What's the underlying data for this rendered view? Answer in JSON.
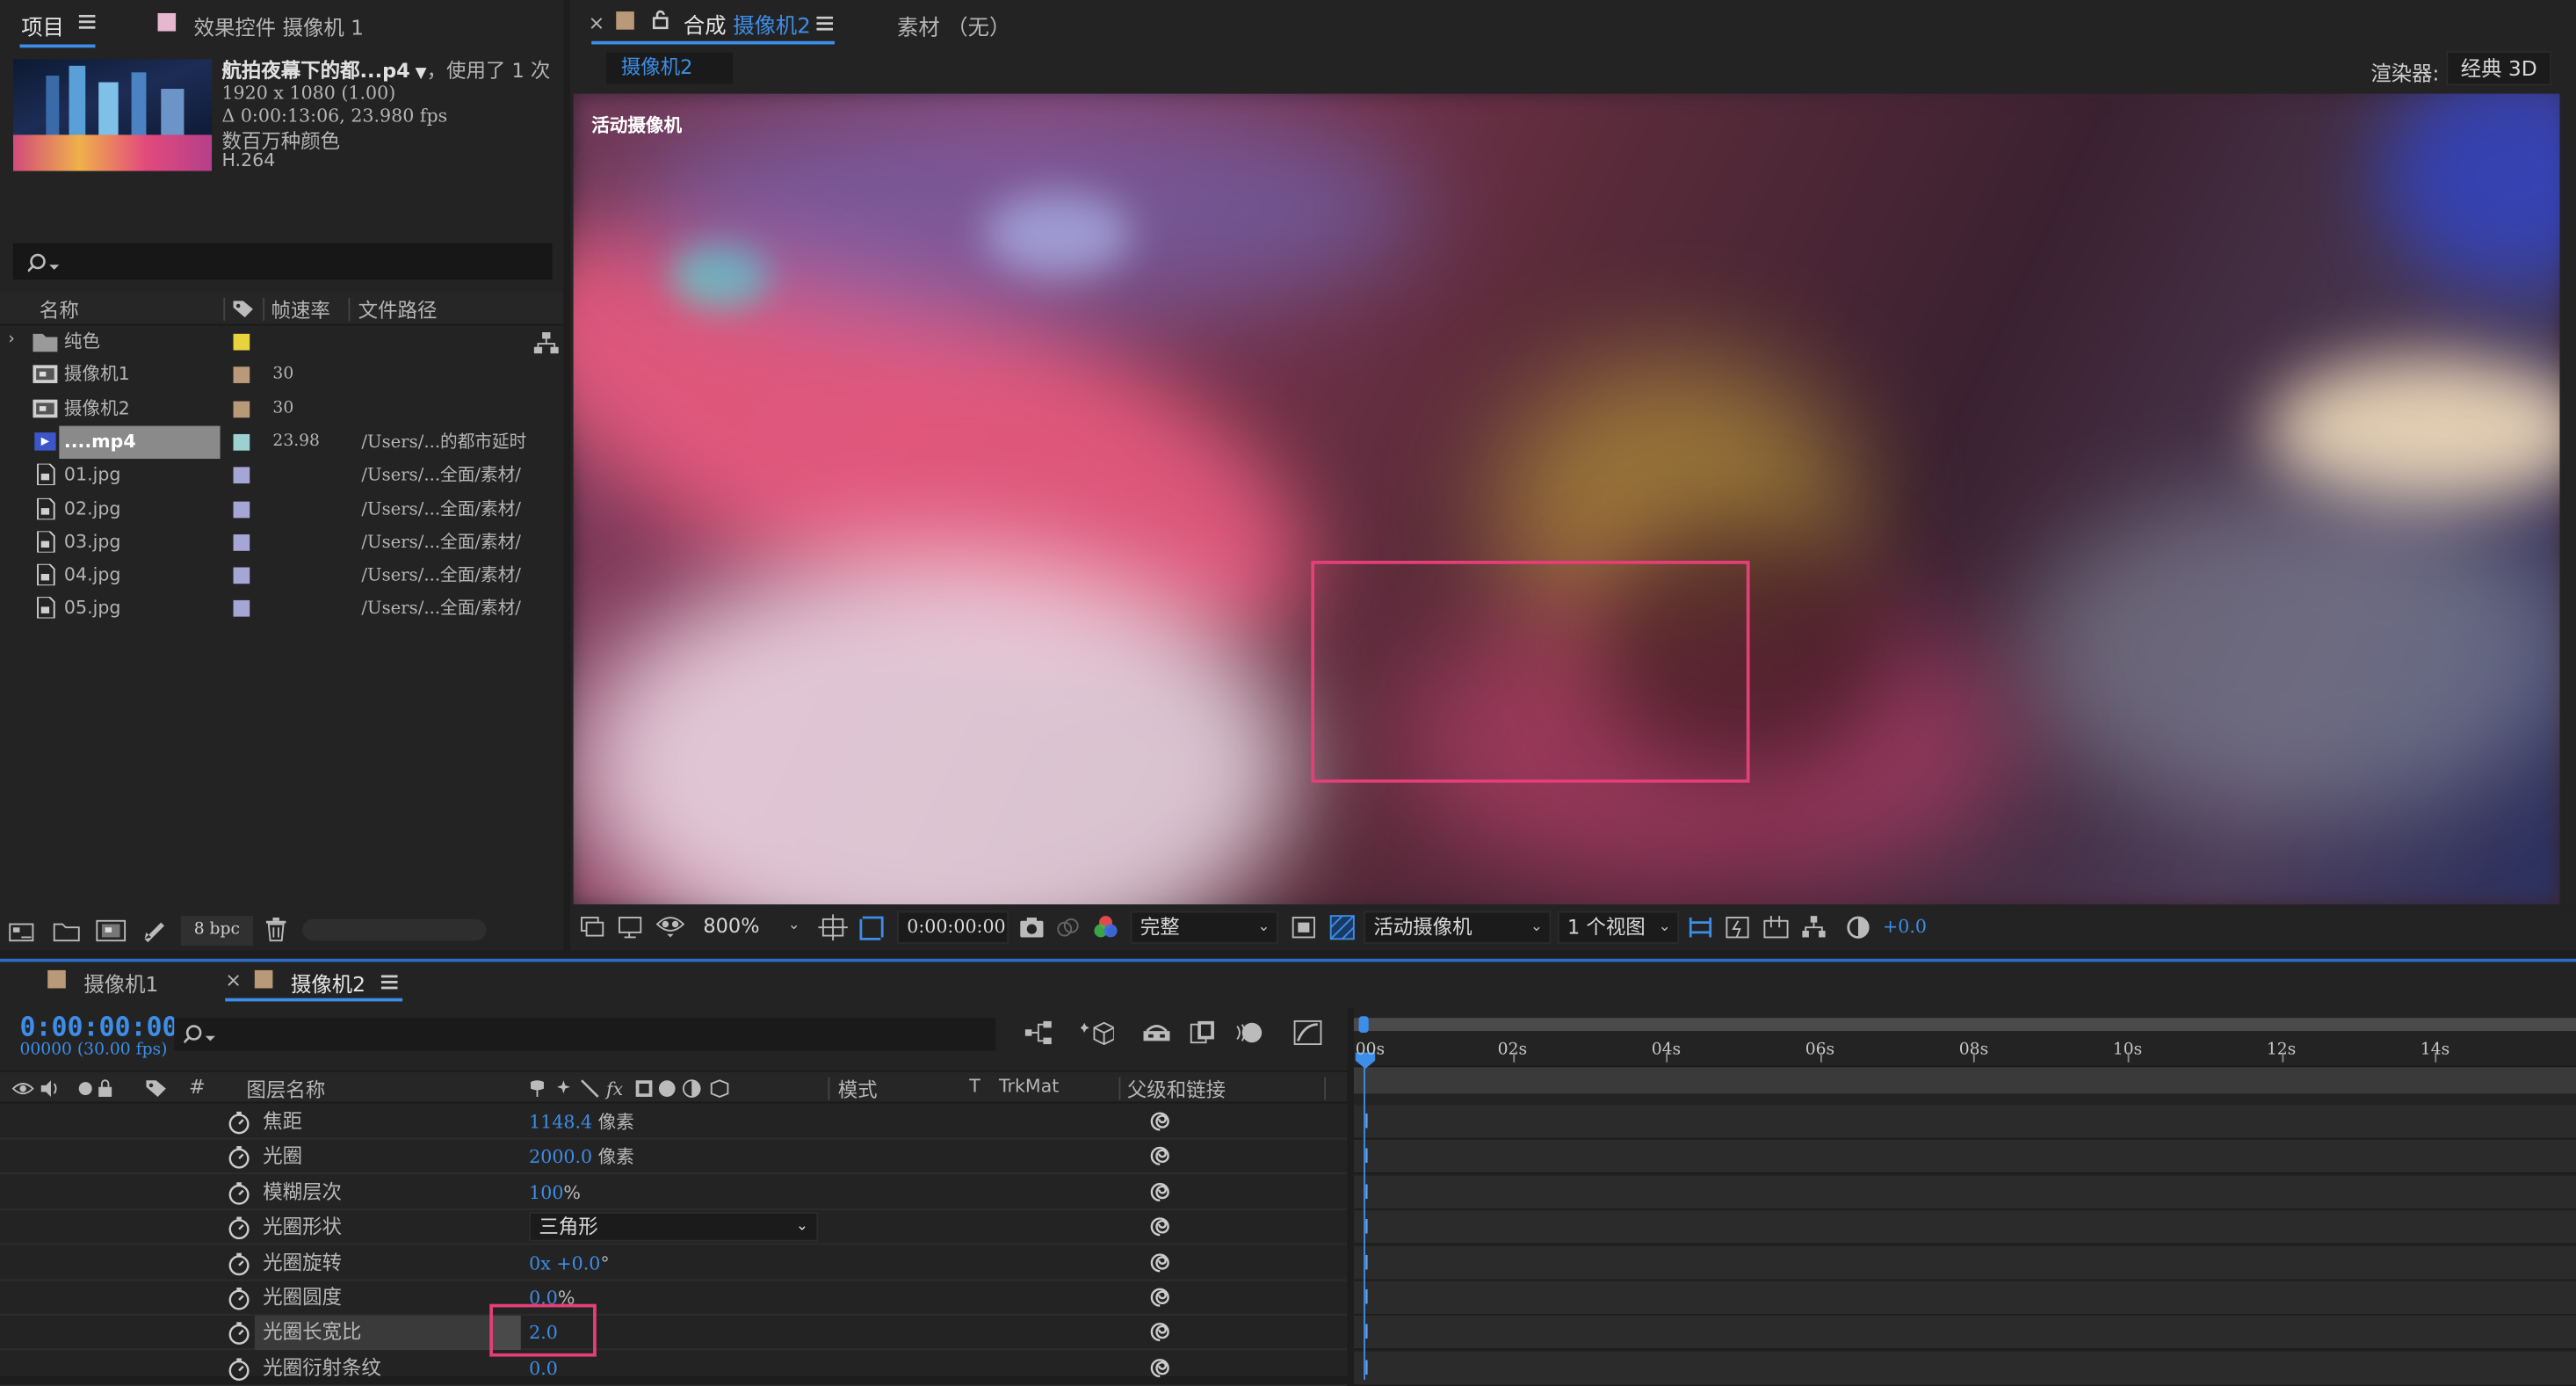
{
  "project_panel": {
    "tab_project": "项目",
    "tab_effects": "效果控件 摄像机 1",
    "preview": {
      "name": "航拍夜幕下的都...p4",
      "usage": "，使用了 1 次",
      "resolution": "1920 x 1080 (1.00)",
      "duration": "Δ 0:00:13:06, 23.980 fps",
      "color": "数百万种颜色",
      "codec": "H.264"
    },
    "search_placeholder": "",
    "columns": {
      "name": "名称",
      "fps": "帧速率",
      "path": "文件路径"
    },
    "items": [
      {
        "name": "纯色",
        "fps": "",
        "path": "",
        "label_color": "#e8d33f",
        "icon": "folder-icon"
      },
      {
        "name": "摄像机1",
        "fps": "30",
        "path": "",
        "label_color": "#b89a78",
        "icon": "composition-icon"
      },
      {
        "name": "摄像机2",
        "fps": "30",
        "path": "",
        "label_color": "#b89a78",
        "icon": "composition-icon"
      },
      {
        "name": "....mp4",
        "fps": "23.98",
        "path": "/Users/...的都市延时",
        "label_color": "#9bd1d1",
        "icon": "video-file-icon",
        "selected": true
      },
      {
        "name": "01.jpg",
        "fps": "",
        "path": "/Users/...全面/素材/",
        "label_color": "#a6a6d6",
        "icon": "image-file-icon"
      },
      {
        "name": "02.jpg",
        "fps": "",
        "path": "/Users/...全面/素材/",
        "label_color": "#a6a6d6",
        "icon": "image-file-icon"
      },
      {
        "name": "03.jpg",
        "fps": "",
        "path": "/Users/...全面/素材/",
        "label_color": "#a6a6d6",
        "icon": "image-file-icon"
      },
      {
        "name": "04.jpg",
        "fps": "",
        "path": "/Users/...全面/素材/",
        "label_color": "#a6a6d6",
        "icon": "image-file-icon"
      },
      {
        "name": "05.jpg",
        "fps": "",
        "path": "/Users/...全面/素材/",
        "label_color": "#a6a6d6",
        "icon": "image-file-icon"
      }
    ],
    "bpc": "8 bpc"
  },
  "comp_panel": {
    "close": "×",
    "tab_comp_prefix": "合成",
    "tab_comp_name": "摄像机2",
    "tab_footage": "素材  （无）",
    "subtab": "摄像机2",
    "renderer_label": "渲染器:",
    "renderer_value": "经典 3D",
    "active_camera_label": "活动摄像机",
    "toolbar": {
      "zoom": "800%",
      "timecode": "0:00:00:00",
      "resolution": "完整",
      "view": "活动摄像机",
      "view_layout": "1 个视图",
      "exposure": "+0.0"
    }
  },
  "timeline": {
    "tabs": [
      {
        "name": "摄像机1",
        "active": false
      },
      {
        "name": "摄像机2",
        "active": true
      }
    ],
    "timecode": "0:00:00:00",
    "frame_info": "00000 (30.00 fps)",
    "columns": {
      "number": "#",
      "layer_name": "图层名称",
      "mode": "模式",
      "t": "T",
      "trkmat": "TrkMat",
      "parent": "父级和链接"
    },
    "ruler": [
      "00s",
      "02s",
      "04s",
      "06s",
      "08s",
      "10s",
      "12s",
      "14s"
    ],
    "properties": [
      {
        "name": "焦距",
        "value": "1148.4",
        "unit": " 像素"
      },
      {
        "name": "光圈",
        "value": "2000.0",
        "unit": " 像素"
      },
      {
        "name": "模糊层次",
        "value": "100",
        "unit": "%"
      },
      {
        "name": "光圈形状",
        "value": "三角形",
        "unit": "",
        "dropdown": true
      },
      {
        "name": "光圈旋转",
        "value": "0x +0.0",
        "unit": "°"
      },
      {
        "name": "光圈圆度",
        "value": "0.0",
        "unit": "%"
      },
      {
        "name": "光圈长宽比",
        "value": "2.0",
        "unit": "",
        "highlighted": true
      },
      {
        "name": "光圈衍射条纹",
        "value": "0.0",
        "unit": ""
      }
    ]
  },
  "colors": {
    "accent": "#3d8ee8",
    "highlight": "#e33f78",
    "panel": "#232323"
  }
}
